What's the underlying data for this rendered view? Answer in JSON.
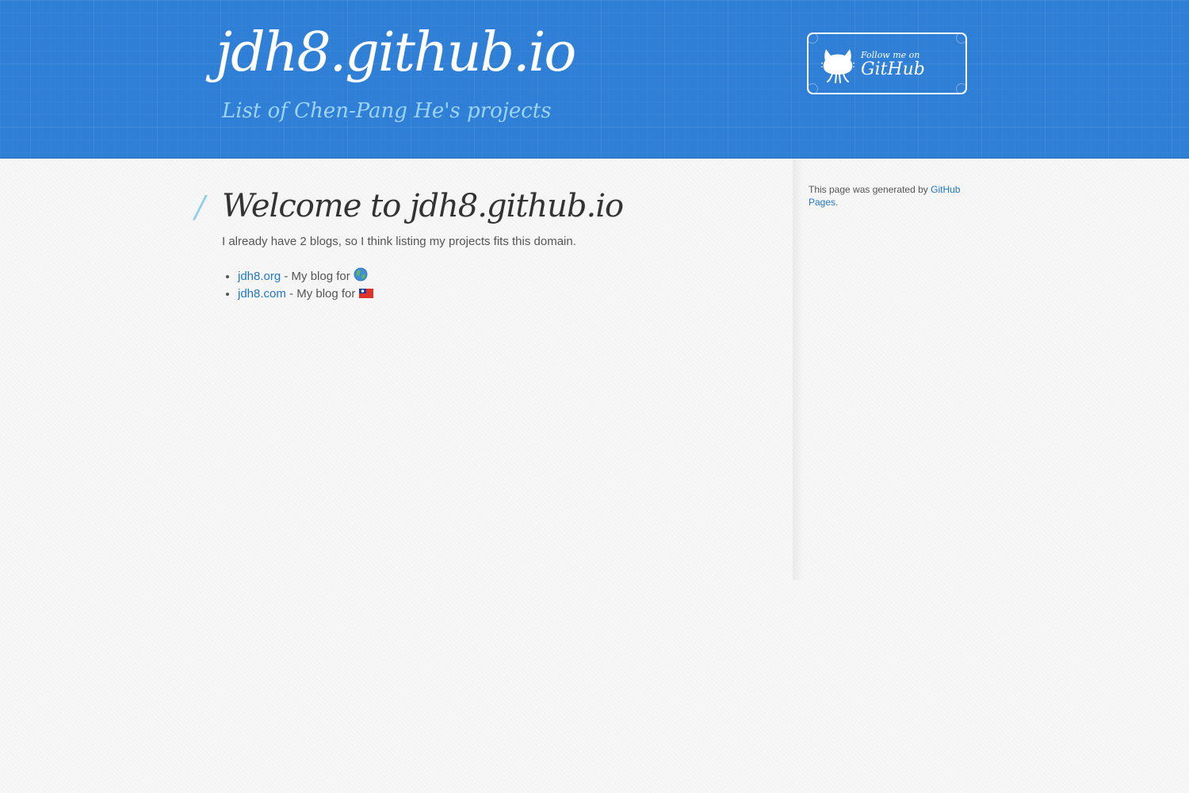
{
  "header": {
    "title": "jdh8.github.io",
    "subtitle": "List of Chen-Pang He's projects",
    "github_button": {
      "small_label": "Follow me on",
      "big_label": "GitHub"
    }
  },
  "main": {
    "heading_decoration": "/",
    "heading": "Welcome to jdh8.github.io",
    "intro": "I already have 2 blogs, so I think listing my projects fits this domain.",
    "blogs": [
      {
        "link": "jdh8.org",
        "description": " - My blog for ",
        "icon": "globe-icon"
      },
      {
        "link": "jdh8.com",
        "description": " - My blog for ",
        "icon": "taiwan-flag-icon"
      }
    ]
  },
  "sidebar": {
    "text_before": "This page was generated by ",
    "link": "GitHub Pages",
    "text_after": "."
  },
  "colors": {
    "header_bg": "#2f7fd6",
    "subtitle": "#9dd4f5",
    "link": "#1f76c9",
    "body_bg": "#f7f7f7"
  }
}
